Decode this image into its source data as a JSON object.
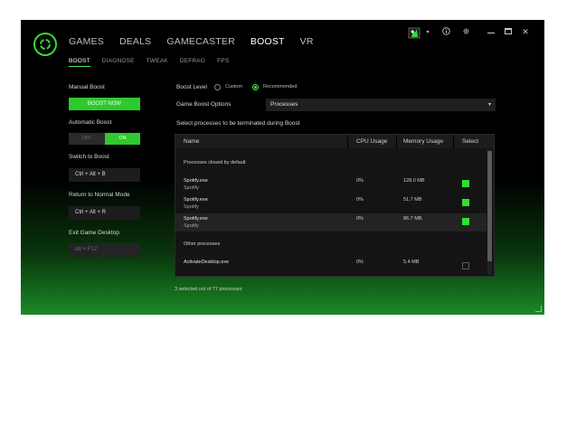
{
  "nav": {
    "main": [
      "GAMES",
      "DEALS",
      "GAMECASTER",
      "BOOST",
      "VR"
    ],
    "main_active": 3,
    "sub": [
      "BOOST",
      "DIAGNOSE",
      "TWEAK",
      "DEFRAG",
      "FPS"
    ],
    "sub_active": 0
  },
  "titlebar": {
    "icons": [
      "avatar-icon",
      "chevron-down-icon",
      "info-icon",
      "gear-icon",
      "minimize-icon",
      "maximize-icon",
      "close-icon"
    ],
    "close_glyph": "✕",
    "min_glyph": "—"
  },
  "left": {
    "manual_boost_label": "Manual Boost",
    "boost_now_label": "BOOST NOW",
    "automatic_boost_label": "Automatic Boost",
    "toggle_off": "OFF",
    "toggle_on": "ON",
    "switch_label": "Switch to Boost",
    "switch_key": "Ctrl + Alt + B",
    "return_label": "Return to Normal Mode",
    "return_key": "Ctrl + Alt + R",
    "exit_label": "Exit Game Desktop",
    "exit_key": "Alt + F12"
  },
  "right": {
    "boost_level_label": "Boost Level",
    "custom_label": "Custom",
    "recommended_label": "Recommended",
    "options_label": "Game Boost Options",
    "options_value": "Processes",
    "instruction": "Select processes to be terminated during Boost"
  },
  "table": {
    "columns": [
      "Name",
      "CPU Usage",
      "Memory Usage",
      "Select"
    ],
    "section_default": "Processes closed by default",
    "section_other": "Other processes",
    "rows_default": [
      {
        "name": "Spotify.exe",
        "sub": "Spotify",
        "cpu": "0%",
        "mem": "128.0 MB",
        "selected": true
      },
      {
        "name": "Spotify.exe",
        "sub": "Spotify",
        "cpu": "0%",
        "mem": "51.7 MB",
        "selected": true
      },
      {
        "name": "Spotify.exe",
        "sub": "Spotify",
        "cpu": "0%",
        "mem": "86.7 MB",
        "selected": true
      }
    ],
    "rows_other": [
      {
        "name": "ActivateDesktop.exe",
        "sub": "",
        "cpu": "0%",
        "mem": "5.4 MB",
        "selected": false
      }
    ]
  },
  "status": "3 selected out of 77 processes",
  "colors": {
    "accent": "#2ec92e",
    "background": "#000000"
  }
}
